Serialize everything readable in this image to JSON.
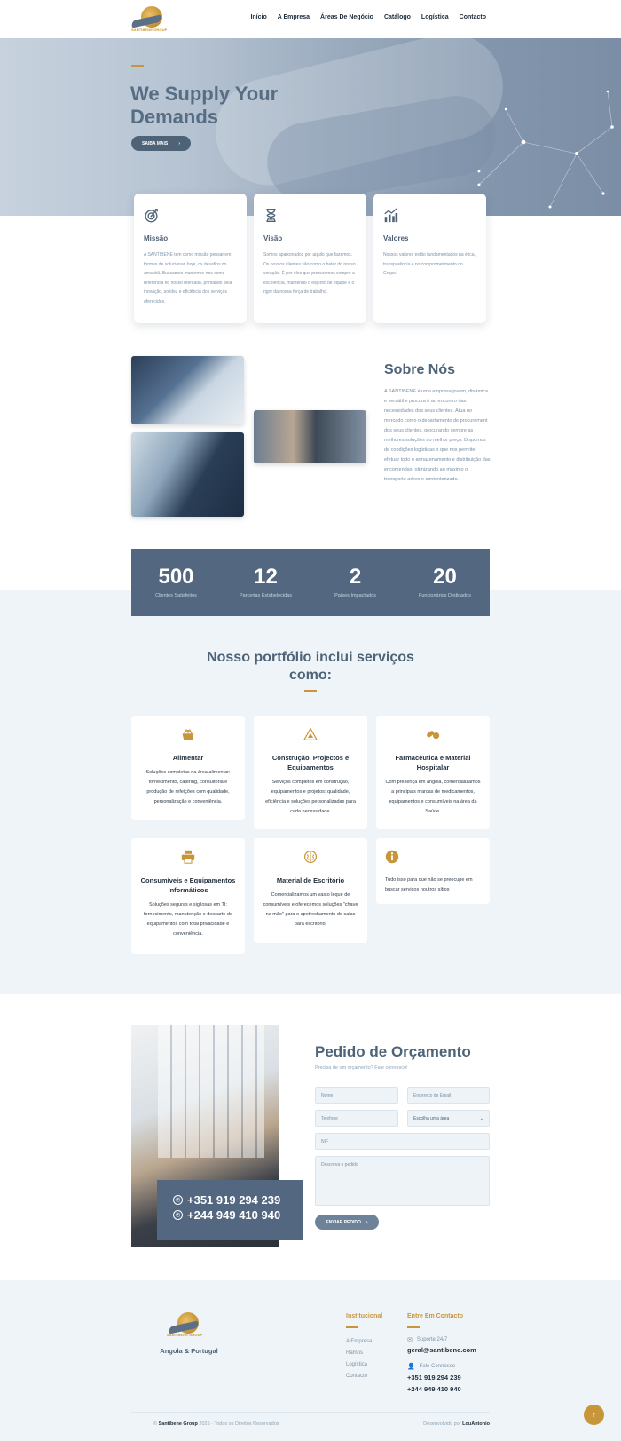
{
  "nav": {
    "logo_text": "SANTIBENE GROUP",
    "items": [
      "Início",
      "A Empresa",
      "Áreas De Negócio",
      "Catálogo",
      "Logística",
      "Contacto"
    ]
  },
  "hero": {
    "eyebrow": "",
    "title": "We Supply Your Demands",
    "button": "SAIBA MAIS",
    "button_arrow": "›"
  },
  "mvv": [
    {
      "icon": "target-icon",
      "title": "Missão",
      "text": "A SANTIBENE tem como missão pensar em formas de solucionar, hoje, os desafios do amanhã. Buscamos mantermo-nos como referência no nosso mercado, primando pela inovação, solidez e eficiência dos serviços oferecidos."
    },
    {
      "icon": "hourglass-icon",
      "title": "Visão",
      "text": "Somos apaixonados por aquilo que fazemos. Os nossos clientes são como o bater do nosso coração. É por eles que procuramos sempre a excelência, mantendo o espírito de equipe e o rigor da nossa força de trabalho."
    },
    {
      "icon": "chart-icon",
      "title": "Valores",
      "text": "Nossos valores estão fundamentados na ética, transparência e no comprometimento do Grupo."
    }
  ],
  "about": {
    "title": "Sobre Nós",
    "text": "A SANTIBENE é uma empresa jovem, dinâmica e versátil e procura ir ao encontro das necessidades dos seus clientes. Atua no mercado como o departamento de procurement dos seus clientes, procurando sempre as melhores soluções ao melhor preço. Dispomos de condições logísticas o que nos permite efetuar todo o armazenamento e distribuição das encomendas, otimizando ao máximo o transporte aéreo e contentorizado."
  },
  "stats": [
    {
      "value": "500",
      "label": "Clientes Satisfeitos"
    },
    {
      "value": "12",
      "label": "Parcerias Estabelecidas"
    },
    {
      "value": "2",
      "label": "Países Impactados"
    },
    {
      "value": "20",
      "label": "Funcionários Dedicados"
    }
  ],
  "portfolio": {
    "title": "Nosso portfólio inclui serviços como:",
    "services": [
      {
        "icon": "food-basket-icon",
        "title": "Alimentar",
        "text": "Soluções completas na área alimentar: fornecimento, catering, consultoria e produção de refeições com qualidade, personalização e conveniência."
      },
      {
        "icon": "construction-icon",
        "title": "Construção, Projectos e Equipamentos",
        "text": "Serviços completos em construção, equipamentos e projetos: qualidade, eficiência e soluções personalizadas para cada necessidade."
      },
      {
        "icon": "pills-icon",
        "title": "Farmacêutica e Material Hospitalar",
        "text": "Com presença em angola, comercializamos a principais marcas de medicamentos, equipamentos e consumíveis na área da Saúde."
      },
      {
        "icon": "printer-icon",
        "title": "Consumíveis e Equipamentos Informáticos",
        "text": "Soluções seguras e sigilosas em TI: fornecimento, manutenção e descarte de equipamentos com total privacidade e conveniência."
      },
      {
        "icon": "brain-icon",
        "title": "Material de Escritório",
        "text": "Comercializamos um vasto leque de consumíveis e oferecemos soluções \"chave na mão\" para o apetrechamento de salas para escritório."
      },
      {
        "icon": "info-icon",
        "title": "",
        "text": "Tudo isso para que não se preocupe em buscar serviços noutros sítios"
      }
    ]
  },
  "quote": {
    "phones": [
      "+351 919 294 239",
      "+244 949 410 940"
    ],
    "title": "Pedido de Orçamento",
    "subtitle": "Precisa de um orçamento? Fale connosco!",
    "fields": {
      "name": "Nome",
      "email": "Endereço de Email",
      "phone": "Telefone",
      "area": "Escolha uma área",
      "nif": "NIF",
      "message": "Descreva o pedido"
    },
    "button": "ENVIAR PEDIDO",
    "button_arrow": "›"
  },
  "footer": {
    "tagline": "Angola & Portugal",
    "institutional_title": "Institucional",
    "links": [
      "A Empresa",
      "Ramos",
      "Logística",
      "Contacto"
    ],
    "contact_title": "Entre Em Contacto",
    "support_label": "Suporte 24/7",
    "email": "geral@santibene.com",
    "talk_label": "Fale Connosco",
    "phones": [
      "+351 919 294 239",
      "+244 949 410 940"
    ],
    "copy_brand": "Santibene Group",
    "copy_rest": " 2025 · Todos os Direitos Reservados",
    "dev_prefix": "Desenvolvido por ",
    "dev_name": "LouAntonio",
    "top_arrow": "↑"
  },
  "colors": {
    "accent": "#c8963a",
    "primary": "#536880",
    "title": "#4d6378"
  }
}
